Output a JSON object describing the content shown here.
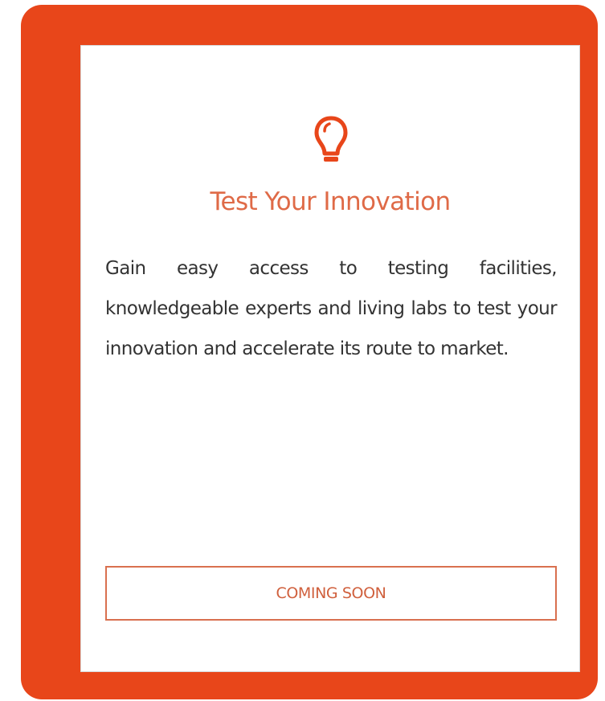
{
  "card": {
    "icon": "lightbulb-icon",
    "title": "Test Your Innovation",
    "description": "Gain easy access to testing facilities, knowledgeable experts and living labs to test your innovation and accelerate its route to market.",
    "button_label": "COMING SOON"
  },
  "colors": {
    "frame": "#e8461a",
    "title": "#df6a47",
    "button_border": "#d9704f",
    "body_text": "#333333"
  }
}
